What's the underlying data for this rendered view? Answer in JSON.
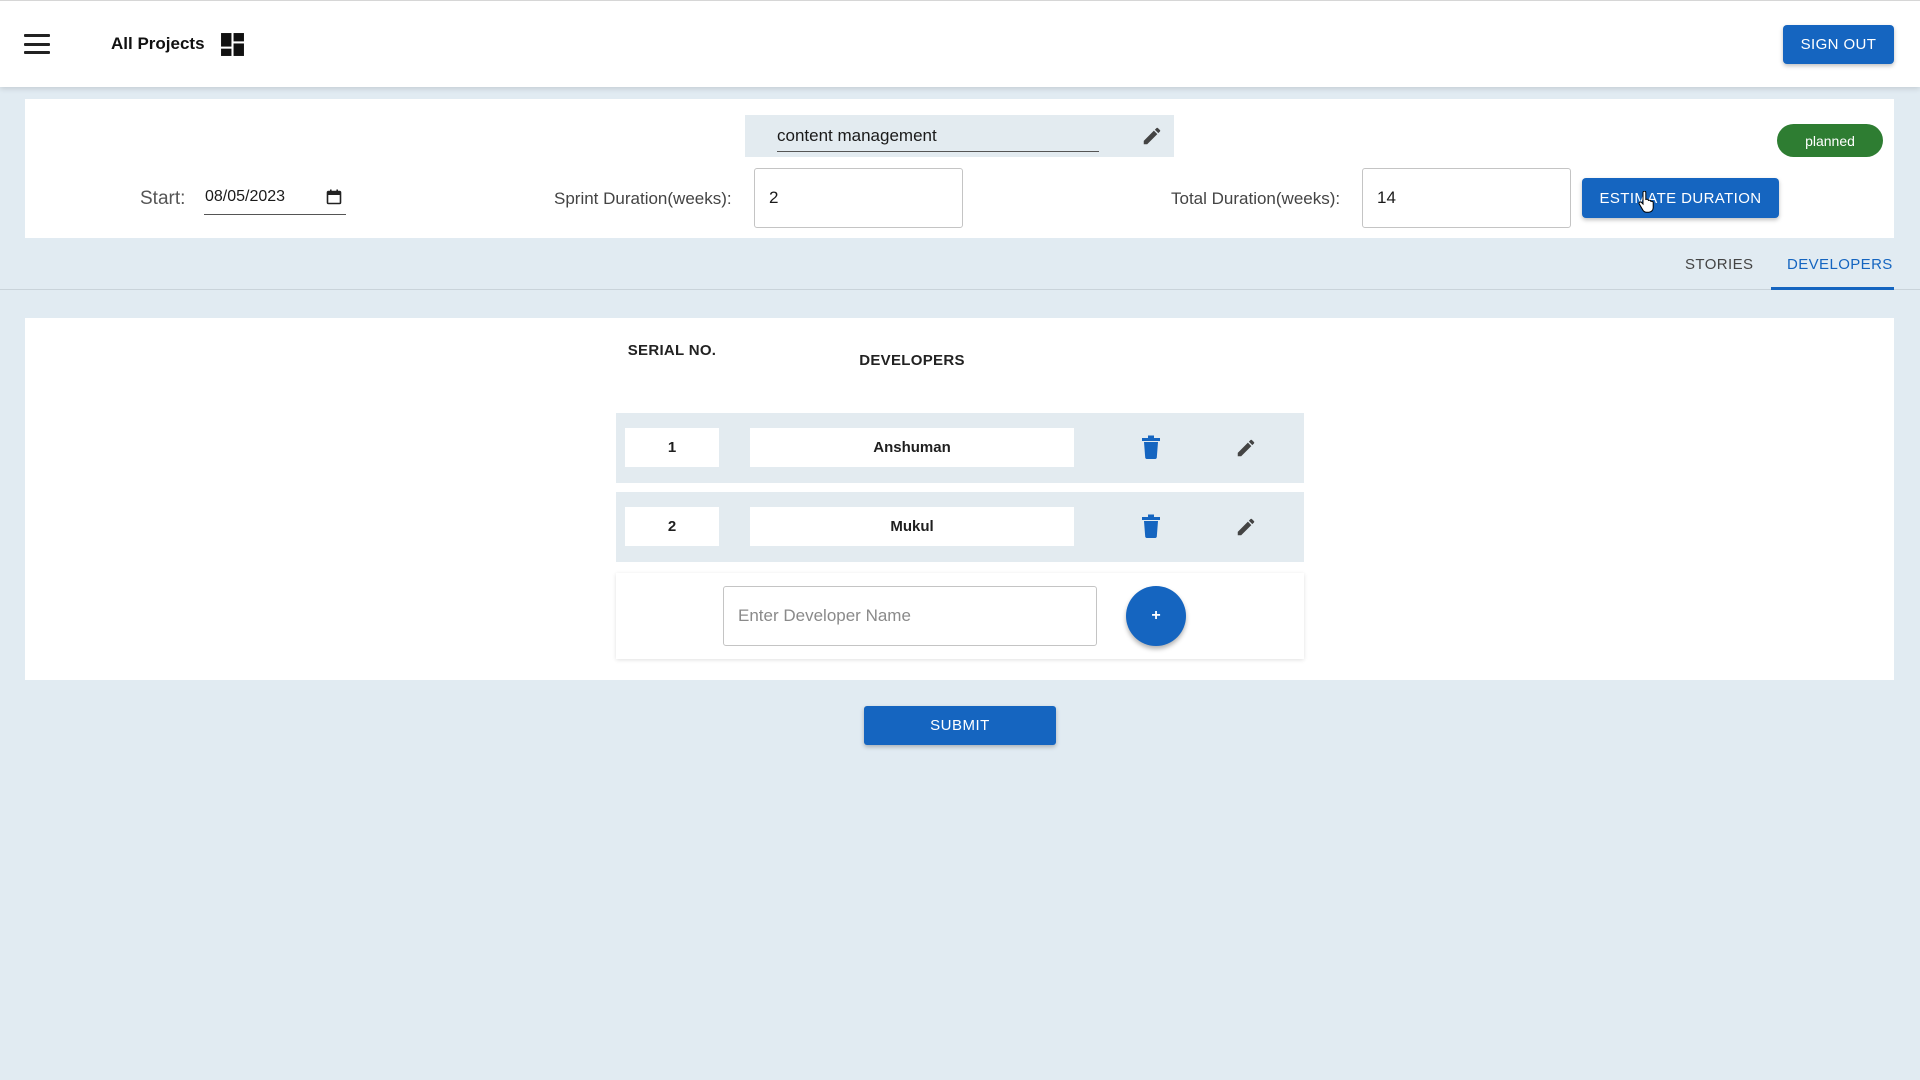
{
  "header": {
    "menu_icon": "hamburger-menu-icon",
    "title": "All Projects",
    "dashboard_icon": "dashboard-icon",
    "sign_out_label": "SIGN OUT"
  },
  "project": {
    "name": "content management",
    "edit_icon": "pencil-icon",
    "status": "planned",
    "status_color": "#2e7d32",
    "start_label": "Start:",
    "start_date": "08/05/2023",
    "calendar_icon": "calendar-icon",
    "sprint_duration_label": "Sprint Duration(weeks):",
    "sprint_duration_value": "2",
    "total_duration_label": "Total Duration(weeks):",
    "total_duration_value": "14",
    "estimate_label": "ESTIMATE DURATION"
  },
  "tabs": [
    {
      "label": "STORIES",
      "active": false
    },
    {
      "label": "DEVELOPERS",
      "active": true
    }
  ],
  "developers": {
    "col_serial": "SERIAL NO.",
    "col_developers": "DEVELOPERS",
    "rows": [
      {
        "serial": "1",
        "name": "Anshuman"
      },
      {
        "serial": "2",
        "name": "Mukul"
      }
    ],
    "new_developer_placeholder": "Enter Developer Name",
    "add_label": "+",
    "delete_icon": "trash-icon",
    "edit_icon": "pencil-icon"
  },
  "submit_label": "SUBMIT",
  "colors": {
    "primary": "#1565c0",
    "background": "#e1ebf2",
    "status_green": "#2e7d32"
  }
}
